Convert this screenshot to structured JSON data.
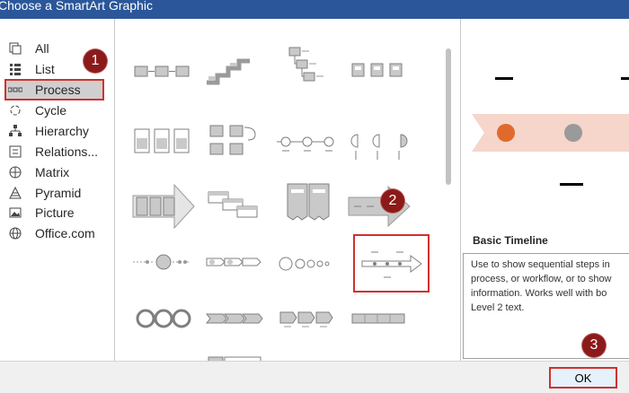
{
  "window": {
    "title": "Choose a SmartArt Graphic"
  },
  "categories": [
    {
      "label": "All",
      "icon": "all-icon"
    },
    {
      "label": "List",
      "icon": "list-icon"
    },
    {
      "label": "Process",
      "icon": "process-icon"
    },
    {
      "label": "Cycle",
      "icon": "cycle-icon"
    },
    {
      "label": "Hierarchy",
      "icon": "hierarchy-icon"
    },
    {
      "label": "Relations...",
      "icon": "relationship-icon"
    },
    {
      "label": "Matrix",
      "icon": "matrix-icon"
    },
    {
      "label": "Pyramid",
      "icon": "pyramid-icon"
    },
    {
      "label": "Picture",
      "icon": "picture-icon"
    },
    {
      "label": "Office.com",
      "icon": "globe-icon"
    }
  ],
  "selected_category": "Process",
  "preview": {
    "title": "Basic Timeline",
    "description_lines": [
      "Use to show sequential steps in",
      "process, or workflow, or to show",
      "information. Works well with bo",
      "Level 2 text."
    ]
  },
  "buttons": {
    "ok": "OK"
  },
  "callouts": [
    "1",
    "2",
    "3"
  ],
  "colors": {
    "accent": "#2b579a",
    "highlight_border": "#d0312d",
    "badge": "#8b1a1a",
    "orange_dot": "#e06a2b",
    "band": "#f6d5cb"
  }
}
